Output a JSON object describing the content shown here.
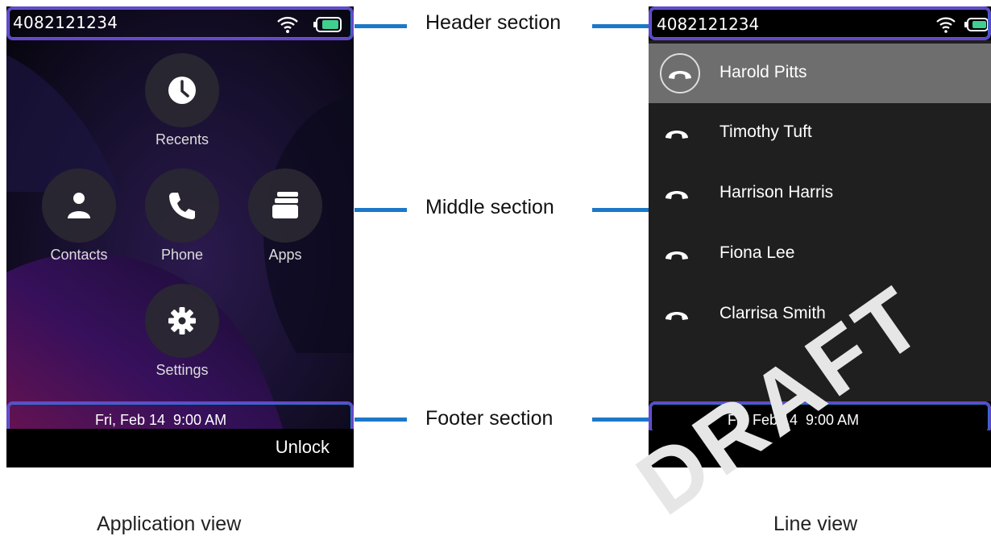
{
  "application_view": {
    "header": {
      "number": "4082121234"
    },
    "apps": [
      {
        "label": "Recents",
        "icon": "clock-icon"
      },
      {
        "label": "Contacts",
        "icon": "person-icon"
      },
      {
        "label": "Phone",
        "icon": "phone-icon"
      },
      {
        "label": "Apps",
        "icon": "stacked-cards-icon"
      },
      {
        "label": "Settings",
        "icon": "gear-icon"
      }
    ],
    "footer": {
      "date_time": "Fri, Feb 14  9:00 AM"
    },
    "softkey": "Unlock"
  },
  "line_view": {
    "header": {
      "number": "4082121234"
    },
    "lines": [
      {
        "name": "Harold Pitts",
        "selected": true
      },
      {
        "name": "Timothy Tuft"
      },
      {
        "name": "Harrison Harris"
      },
      {
        "name": "Fiona Lee"
      },
      {
        "name": "Clarrisa Smith"
      }
    ],
    "footer": {
      "date_time": "Fri, Feb 14  9:00 AM"
    },
    "softkey": "..."
  },
  "annotations": {
    "header": "Header section",
    "middle": "Middle section",
    "footer": "Footer section"
  },
  "captions": {
    "left": "Application view",
    "right": "Line view"
  },
  "watermark": "DRAFT",
  "colors": {
    "outline": "#6448c8",
    "leader_line": "#1c78c8",
    "battery": "#3fcf8e",
    "selected_row": "#6e6e6e"
  }
}
